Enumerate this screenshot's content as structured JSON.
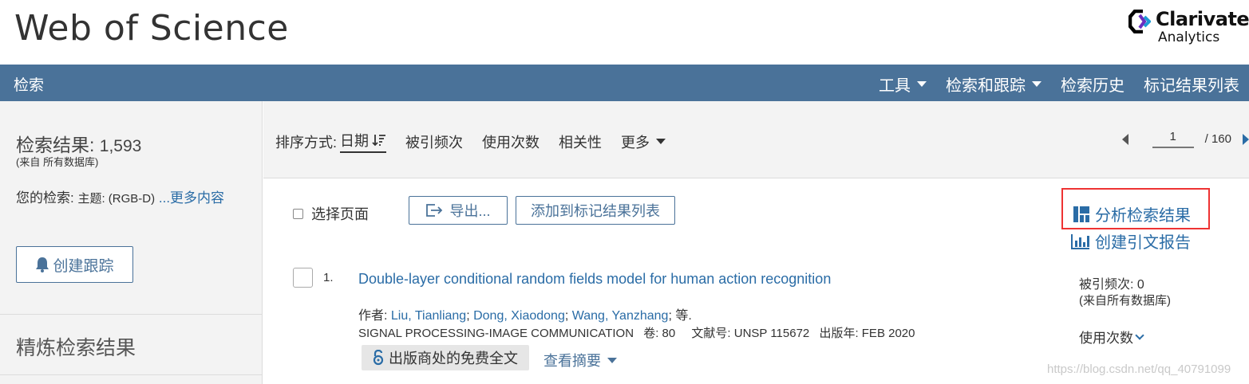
{
  "header": {
    "app_title": "Web of Science",
    "brand_name": "Clarivate",
    "brand_sub": "Analytics"
  },
  "nav": {
    "search": "检索",
    "items": [
      {
        "label": "工具",
        "dropdown": true
      },
      {
        "label": "检索和跟踪",
        "dropdown": true
      },
      {
        "label": "检索历史",
        "dropdown": false
      },
      {
        "label": "标记结果列表",
        "dropdown": false
      }
    ]
  },
  "sidebar": {
    "results_label": "检索结果:",
    "results_count": "1,593",
    "results_source": "(来自 所有数据库)",
    "your_search_label": "您的检索:",
    "query": "主题: (RGB-D)",
    "more_link": "...更多内容",
    "create_alert": "创建跟踪",
    "refine_title": "精炼检索结果"
  },
  "sortbar": {
    "label": "排序方式:",
    "active": "日期",
    "options": [
      "被引频次",
      "使用次数",
      "相关性"
    ],
    "more": "更多"
  },
  "pager": {
    "current": "1",
    "total": "/ 160"
  },
  "toolbar": {
    "select_page": "选择页面",
    "export": "导出...",
    "add_to_marked": "添加到标记结果列表",
    "analyze": "分析检索结果",
    "citation_report": "创建引文报告"
  },
  "record": {
    "number": "1.",
    "title": "Double-layer conditional random fields model for human action recognition",
    "authors_label": "作者:",
    "authors": [
      "Liu, Tianliang",
      "Dong, Xiaodong",
      "Wang, Yanzhang"
    ],
    "authors_more": "等.",
    "journal": "SIGNAL PROCESSING-IMAGE COMMUNICATION",
    "volume": "卷: 80",
    "article_no": "文献号: UNSP 115672",
    "pub_year": "出版年: FEB 2020",
    "free_full_text": "出版商处的免费全文",
    "view_abstract": "查看摘要",
    "cited_label": "被引频次: 0",
    "cited_source": "(来自所有数据库)",
    "usage_label": "使用次数"
  },
  "watermark": "https://blog.csdn.net/qq_40791099",
  "colors": {
    "nav_bg": "#4a7299",
    "link": "#2a6ca6",
    "highlight_box": "#e33333",
    "panel_bg": "#f3f3f3"
  },
  "icons": {
    "sort_desc": "sort-descending-icon",
    "export": "export-icon",
    "bell": "bell-icon",
    "analyze": "bar-grid-icon",
    "citation": "bar-chart-icon",
    "open_access": "open-access-lock-icon"
  }
}
